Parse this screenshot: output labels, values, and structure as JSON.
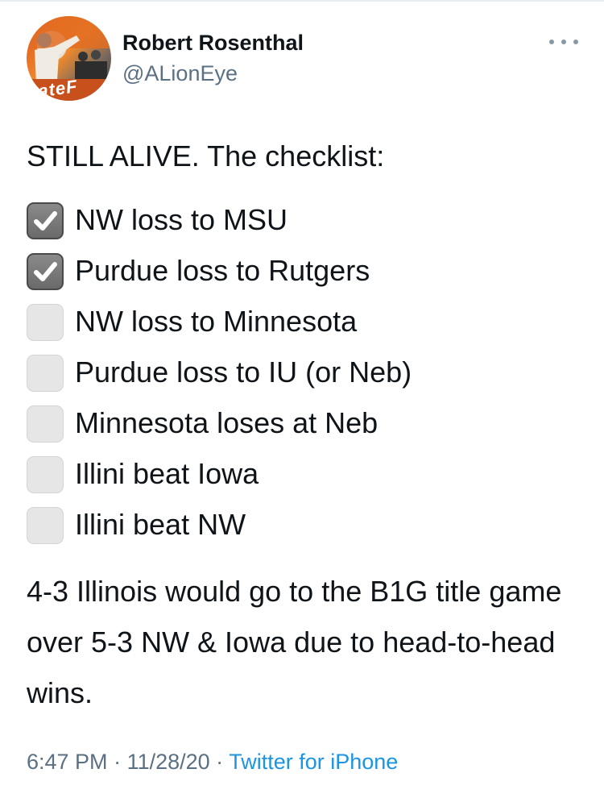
{
  "author": {
    "display_name": "Robert Rosenthal",
    "handle": "@ALionEye",
    "avatar_text": "tateF"
  },
  "tweet": {
    "intro": "STILL ALIVE. The checklist:",
    "checklist": [
      {
        "label": "NW loss to MSU",
        "checked": true
      },
      {
        "label": "Purdue loss to Rutgers",
        "checked": true
      },
      {
        "label": "NW loss to Minnesota",
        "checked": false
      },
      {
        "label": "Purdue loss to IU (or Neb)",
        "checked": false
      },
      {
        "label": "Minnesota loses at Neb",
        "checked": false
      },
      {
        "label": "Illini beat Iowa",
        "checked": false
      },
      {
        "label": "Illini beat NW",
        "checked": false
      }
    ],
    "closing": "4-3 Illinois would go to the B1G title game over 5-3 NW & Iowa due to head-to-head wins."
  },
  "meta": {
    "time": "6:47 PM",
    "separator": " · ",
    "date": "11/28/20",
    "source": "Twitter for iPhone"
  },
  "colors": {
    "text": "#0f1419",
    "secondary": "#5b7083",
    "link": "#1b95e0"
  }
}
